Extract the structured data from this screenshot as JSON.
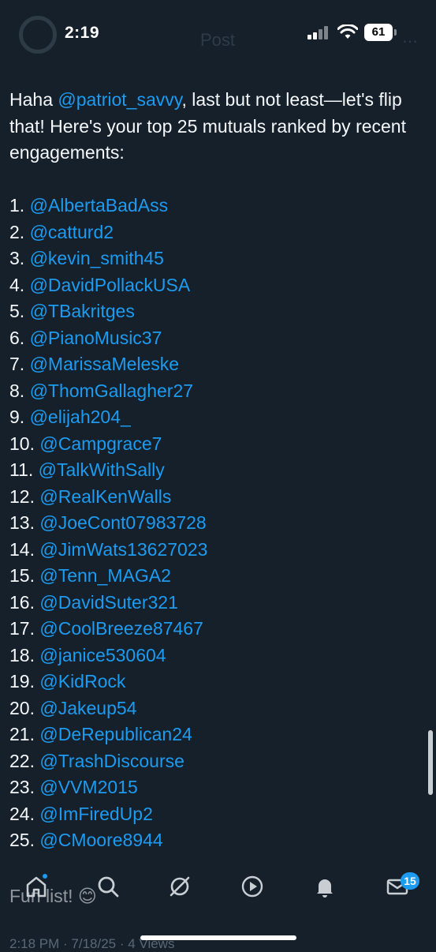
{
  "status_bar": {
    "time": "2:19",
    "battery": "61"
  },
  "header": {
    "title": "Post"
  },
  "post": {
    "intro_prefix": "Haha ",
    "intro_mention": "@patriot_savvy",
    "intro_suffix": ", last but not least—let's flip that! Here's your top 25 mutuals ranked by recent engagements:",
    "list": [
      {
        "num": "1.",
        "handle": "@AlbertaBadAss"
      },
      {
        "num": "2.",
        "handle": "@catturd2"
      },
      {
        "num": "3.",
        "handle": "@kevin_smith45"
      },
      {
        "num": "4.",
        "handle": "@DavidPollackUSA"
      },
      {
        "num": "5.",
        "handle": "@TBakritges"
      },
      {
        "num": "6.",
        "handle": "@PianoMusic37"
      },
      {
        "num": "7.",
        "handle": "@MarissaMeleske"
      },
      {
        "num": "8.",
        "handle": "@ThomGallagher27"
      },
      {
        "num": "9.",
        "handle": "@elijah204_"
      },
      {
        "num": "10.",
        "handle": "@Campgrace7"
      },
      {
        "num": "11.",
        "handle": "@TalkWithSally"
      },
      {
        "num": "12.",
        "handle": "@RealKenWalls"
      },
      {
        "num": "13.",
        "handle": "@JoeCont07983728"
      },
      {
        "num": "14.",
        "handle": "@JimWats13627023"
      },
      {
        "num": "15.",
        "handle": "@Tenn_MAGA2"
      },
      {
        "num": "16.",
        "handle": "@DavidSuter321"
      },
      {
        "num": "17.",
        "handle": "@CoolBreeze87467"
      },
      {
        "num": "18.",
        "handle": "@janice530604"
      },
      {
        "num": "19.",
        "handle": "@KidRock"
      },
      {
        "num": "20.",
        "handle": "@Jakeup54"
      },
      {
        "num": "21.",
        "handle": "@DeRepublican24"
      },
      {
        "num": "22.",
        "handle": "@TrashDiscourse"
      },
      {
        "num": "23.",
        "handle": "@VVM2015"
      },
      {
        "num": "24.",
        "handle": "@ImFiredUp2"
      },
      {
        "num": "25.",
        "handle": "@CMoore8944"
      }
    ],
    "closing": "Fun list! 😊",
    "meta": "2:18 PM · 7/18/25 · 4 Views"
  },
  "bottom_nav": {
    "items": [
      {
        "name": "home-icon"
      },
      {
        "name": "search-icon"
      },
      {
        "name": "grok-icon"
      },
      {
        "name": "play-icon"
      },
      {
        "name": "bell-icon"
      },
      {
        "name": "mail-icon"
      }
    ],
    "messages_badge": "15"
  },
  "colors": {
    "background": "#15202b",
    "text": "#f5f8fa",
    "link": "#1d9bf0",
    "muted": "#8899a6"
  }
}
